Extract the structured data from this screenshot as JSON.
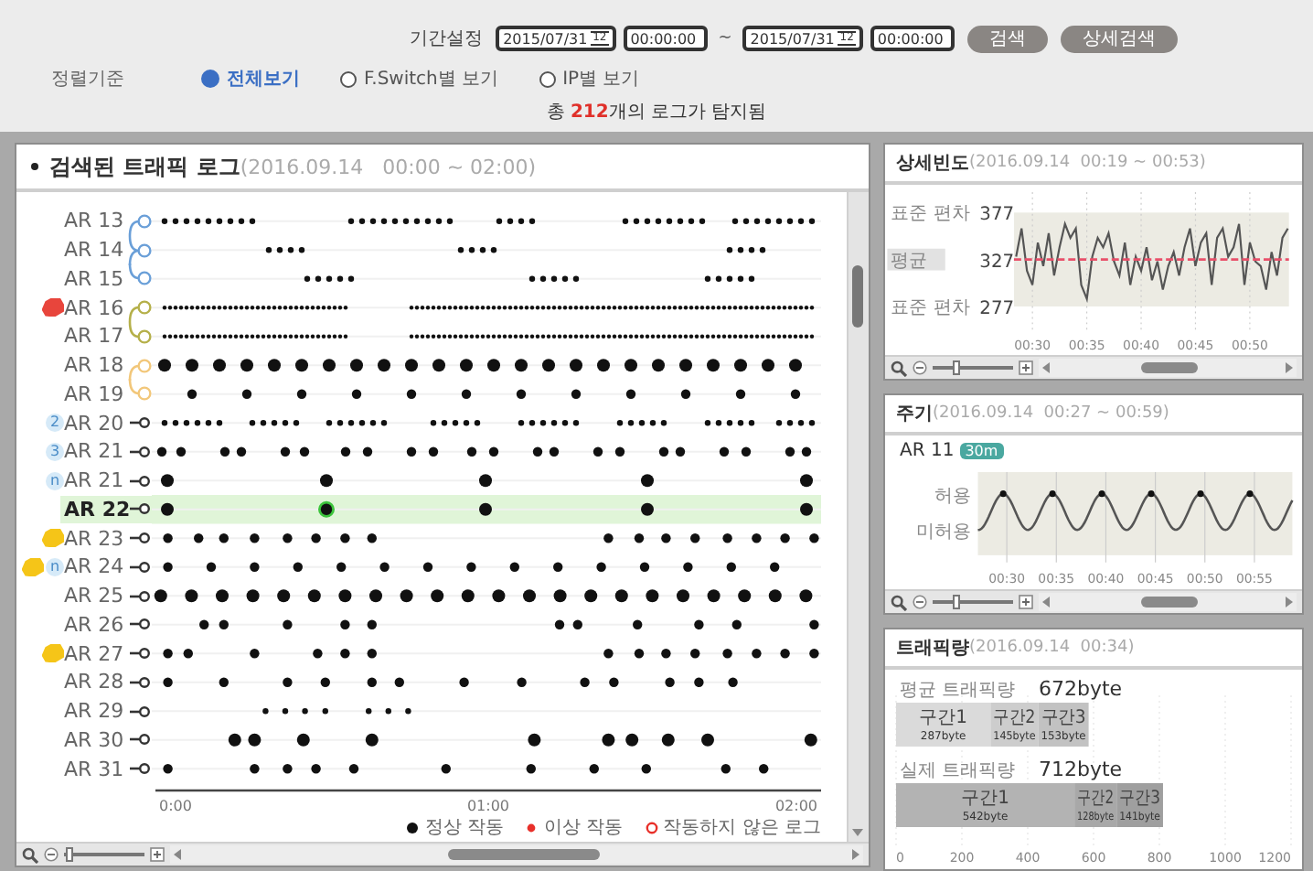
{
  "filter": {
    "period_label": "기간설정",
    "from_date": "2015/07/31",
    "from_calendar_text": "12",
    "from_time": "00:00:00",
    "separator": "~",
    "to_date": "2015/07/31",
    "to_calendar_text": "12",
    "to_time": "00:00:00",
    "buttons": [
      "검색",
      "상세검색"
    ]
  },
  "sort": {
    "label": "정렬기준",
    "options": [
      {
        "label": "전체보기",
        "selected": true
      },
      {
        "label": "F.Switch별 보기",
        "selected": false
      },
      {
        "label": "IP별 보기",
        "selected": false
      }
    ]
  },
  "summary": {
    "prefix": "총 ",
    "count": "212",
    "suffix": "개의 로그가 탐지됨"
  },
  "log_panel": {
    "title": "검색된 트래픽 로그",
    "subtitle": "(2016.09.14   00:00 ~ 02:00)",
    "rows": [
      {
        "label": "AR 13",
        "selected": false,
        "link": {
          "kind": "start",
          "color": "#6a9fd8"
        }
      },
      {
        "label": "AR 14",
        "selected": false,
        "link": {
          "kind": "middle",
          "color": "#6a9fd8"
        }
      },
      {
        "label": "AR 15",
        "selected": false,
        "link": {
          "kind": "end",
          "color": "#6a9fd8"
        }
      },
      {
        "label": "AR 16",
        "selected": false,
        "tag": {
          "color": "#e8453c"
        },
        "link": {
          "kind": "start",
          "color": "#b5b04a"
        }
      },
      {
        "label": "AR 17",
        "selected": false,
        "link": {
          "kind": "end",
          "color": "#b5b04a"
        }
      },
      {
        "label": "AR 18",
        "selected": false,
        "link": {
          "kind": "start",
          "color": "#f2c77a"
        }
      },
      {
        "label": "AR 19",
        "selected": false,
        "link": {
          "kind": "end",
          "color": "#f2c77a"
        }
      },
      {
        "label": "AR 20",
        "selected": false,
        "badge": "2"
      },
      {
        "label": "AR 21",
        "selected": false,
        "badge": "3"
      },
      {
        "label": "AR 21",
        "selected": false,
        "badge": "n"
      },
      {
        "label": "AR 22",
        "selected": true
      },
      {
        "label": "AR 23",
        "selected": false,
        "tag": {
          "color": "#f5c518"
        }
      },
      {
        "label": "AR 24",
        "selected": false,
        "tag": {
          "color": "#f5c518"
        },
        "badge": "n"
      },
      {
        "label": "AR 25",
        "selected": false
      },
      {
        "label": "AR 26",
        "selected": false
      },
      {
        "label": "AR 27",
        "selected": false,
        "tag": {
          "color": "#f5c518"
        }
      },
      {
        "label": "AR 28",
        "selected": false
      },
      {
        "label": "AR 29",
        "selected": false
      },
      {
        "label": "AR 30",
        "selected": false
      },
      {
        "label": "AR 31",
        "selected": false
      }
    ],
    "axis_labels": [
      "0:00",
      "01:00",
      "02:00"
    ],
    "legend": [
      {
        "kind": "normal",
        "label": "정상 작동",
        "color": "#111111"
      },
      {
        "kind": "error",
        "label": "이상 작동",
        "color": "#e8302a"
      },
      {
        "kind": "missing",
        "label": "작동하지 않은 로그",
        "color": "#e8302a"
      }
    ],
    "zoom": {
      "level": 0.02
    }
  },
  "detail_panel": {
    "title": "상세빈도",
    "subtitle": "(2016.09.14  00:19 ~ 00:53)",
    "y_captions": [
      "표준 편차",
      "평균",
      "표준 편차"
    ],
    "chart_data": {
      "type": "line",
      "xlim": [
        28.3,
        53.6
      ],
      "ylim": [
        260,
        395
      ],
      "grid": true,
      "x": [
        28.5,
        29,
        29.5,
        30,
        30.5,
        31,
        31.5,
        32,
        32.5,
        33,
        33.5,
        34,
        34.5,
        35,
        35.5,
        36,
        36.5,
        37,
        37.5,
        38,
        38.5,
        39,
        39.5,
        40,
        40.5,
        41,
        41.5,
        42,
        42.5,
        43,
        43.5,
        44,
        44.5,
        45,
        45.5,
        46,
        46.5,
        47,
        47.5,
        48,
        48.5,
        49,
        49.5,
        50,
        50.5,
        51,
        51.5,
        52,
        52.5,
        53,
        53.5
      ],
      "xticks": [
        {
          "value": 30,
          "label": "00:30"
        },
        {
          "value": 35,
          "label": "00:35"
        },
        {
          "value": 40,
          "label": "00:40"
        },
        {
          "value": 45,
          "label": "00:45"
        },
        {
          "value": 50,
          "label": "00:50"
        }
      ],
      "yticks": [
        {
          "value": 377,
          "label": "377"
        },
        {
          "value": 327,
          "label": "327"
        },
        {
          "value": 277,
          "label": "277"
        }
      ],
      "series": [
        {
          "color": "#555555",
          "values": [
            330,
            360,
            315,
            300,
            345,
            320,
            355,
            310,
            340,
            365,
            350,
            360,
            300,
            285,
            330,
            350,
            340,
            355,
            325,
            310,
            345,
            300,
            330,
            315,
            340,
            305,
            325,
            295,
            320,
            335,
            310,
            340,
            360,
            320,
            345,
            355,
            300,
            350,
            360,
            330,
            340,
            365,
            300,
            345,
            325,
            320,
            295,
            335,
            310,
            350,
            360
          ]
        }
      ],
      "ref_lines": [
        {
          "axis": "y",
          "value": 327,
          "color": "#e8506a"
        }
      ],
      "bands": [
        {
          "axis": "y",
          "from": 277,
          "to": 377,
          "color": "#ecebe3"
        }
      ]
    },
    "zoom": {
      "level": 0.25
    }
  },
  "cycle_panel": {
    "title": "주기",
    "subtitle": "(2016.09.14  00:27 ~ 00:59)",
    "item_label": "AR 11",
    "period_badge": "30m",
    "y_labels": [
      "허용",
      "미허용"
    ],
    "x_labels": [
      "00:30",
      "00:35",
      "00:40",
      "00:45",
      "00:50",
      "00:55"
    ],
    "zoom": {
      "level": 0.25
    }
  },
  "volume_panel": {
    "title": "트래픽량",
    "subtitle": "(2016.09.14  00:34)",
    "totals": [
      "672byte",
      "712byte"
    ],
    "chart_data": {
      "type": "bar",
      "orientation": "horizontal",
      "stacked": true,
      "grid": true,
      "categories": [
        "평균 트래픽량",
        "실제 트래픽량"
      ],
      "xlim": [
        0,
        1200
      ],
      "xticks": [
        0,
        200,
        400,
        600,
        800,
        1000,
        1200
      ],
      "series": [
        {
          "name": "구간1",
          "color": "#dadada",
          "values": [
            287,
            542
          ]
        },
        {
          "name": "구간2",
          "color": "#cdcdcd",
          "values": [
            145,
            128
          ]
        },
        {
          "name": "구간3",
          "color": "#c2c2c2",
          "values": [
            153,
            141
          ]
        }
      ],
      "value_labels": [
        [
          "287byte",
          "145byte",
          "153byte"
        ],
        [
          "542byte",
          "128byte",
          "141byte"
        ]
      ]
    }
  }
}
